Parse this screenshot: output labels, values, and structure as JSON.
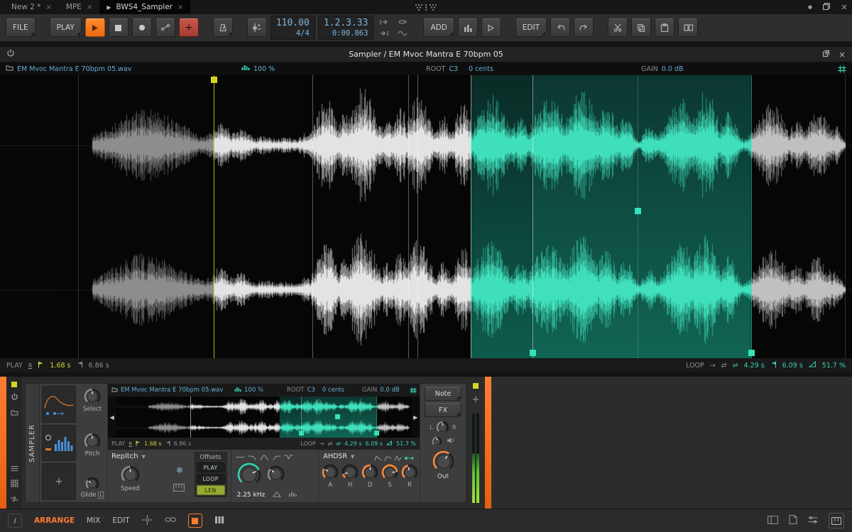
{
  "titlebar": {
    "tabs": [
      {
        "label": "New 2 *",
        "close": "×"
      },
      {
        "label": "MPE",
        "close": "×"
      },
      {
        "label": "BWS4_Sampler",
        "close": "×",
        "play": "▶"
      }
    ],
    "window": {
      "dot": "●",
      "close": "×"
    }
  },
  "toolbar": {
    "file": "FILE",
    "play": "PLAY",
    "tempo": "110.00",
    "timesig": "4/4",
    "position": "1.2.3.33",
    "time": "0:00.863",
    "add": "ADD",
    "edit": "EDIT"
  },
  "editor": {
    "title": "Sampler / EM Mvoc Mantra E 70bpm 05",
    "filename": "EM Mvoc Mantra E 70bpm 05.wav",
    "stretch": "100 %",
    "root_label": "ROOT",
    "root": "C3",
    "cents": "0 cents",
    "gain_label": "GAIN",
    "gain": "0.0 dB",
    "play_label": "PLAY",
    "reverse": "R",
    "play_start": "1.68 s",
    "play_end": "6.86 s",
    "loop_label": "LOOP",
    "loop_start": "4.29 s",
    "loop_end": "6.09 s",
    "loop_pct": "51.7 %"
  },
  "device": {
    "name": "SAMPLER",
    "select": "Select",
    "pitch": "Pitch",
    "glide": "Glide",
    "glide_badge": "L",
    "mode": "Repitch",
    "speed": "Speed",
    "offsets": {
      "title": "Offsets",
      "play": "PLAY",
      "loop": "LOOP",
      "len": "LEN"
    },
    "cutoff": "2.25 kHz",
    "env_title": "AHDSR",
    "env": [
      "A",
      "H",
      "D",
      "S",
      "R"
    ],
    "note": "Note",
    "fx": "FX",
    "pan_l": "L",
    "pan_r": "R",
    "out": "Out",
    "add": "+"
  },
  "statusbar": {
    "info": "i",
    "arrange": "ARRANGE",
    "mix": "MIX",
    "edit": "EDIT"
  },
  "waveform": {
    "span": [
      0.108,
      0.992
    ],
    "region": [
      0.5525,
      0.8815
    ],
    "marks": {
      "sstart": 0.0915,
      "play": 0.2505,
      "s1": 0.3665,
      "s2": 0.479,
      "s3": 0.49,
      "rstart": 0.5525,
      "loop_start": 0.625,
      "mid": 0.748,
      "rend": 0.8815,
      "send": 0.9915
    },
    "lanes": [
      [
        0.005,
        0.49
      ],
      [
        0.515,
        1.0
      ]
    ],
    "colors": {
      "dim": "#909090",
      "lit": "#e8e8e8",
      "teal": "#41e3bf",
      "after": "#c4c4c4"
    },
    "blobs": [
      [
        0.172,
        0.055,
        0.55
      ],
      [
        0.258,
        0.018,
        0.32
      ],
      [
        0.283,
        0.015,
        0.25
      ],
      [
        0.31,
        0.02,
        0.12
      ],
      [
        0.335,
        0.018,
        0.1
      ],
      [
        0.36,
        0.012,
        0.18
      ],
      [
        0.383,
        0.016,
        0.7
      ],
      [
        0.404,
        0.012,
        0.5
      ],
      [
        0.425,
        0.02,
        0.88
      ],
      [
        0.455,
        0.012,
        0.4
      ],
      [
        0.47,
        0.01,
        0.6
      ],
      [
        0.492,
        0.016,
        0.8
      ],
      [
        0.52,
        0.01,
        0.45
      ],
      [
        0.543,
        0.012,
        0.65
      ],
      [
        0.576,
        0.022,
        0.78
      ],
      [
        0.61,
        0.014,
        0.4
      ],
      [
        0.644,
        0.024,
        0.7
      ],
      [
        0.683,
        0.022,
        0.85
      ],
      [
        0.712,
        0.015,
        0.6
      ],
      [
        0.733,
        0.012,
        0.45
      ],
      [
        0.762,
        0.01,
        0.3
      ],
      [
        0.8,
        0.022,
        0.7
      ],
      [
        0.828,
        0.018,
        0.85
      ],
      [
        0.855,
        0.012,
        0.5
      ],
      [
        0.905,
        0.022,
        0.62
      ],
      [
        0.934,
        0.012,
        0.4
      ],
      [
        0.96,
        0.018,
        0.5
      ],
      [
        0.98,
        0.008,
        0.3
      ]
    ]
  }
}
